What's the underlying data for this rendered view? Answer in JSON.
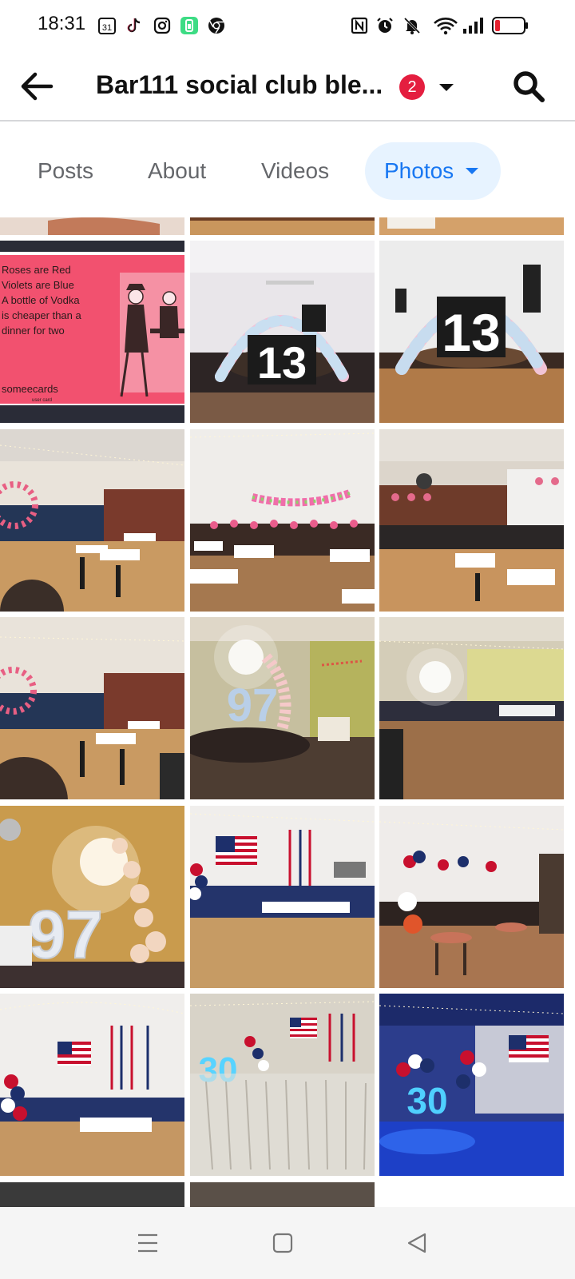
{
  "status_bar": {
    "time": "18:31",
    "calendar_day": "31",
    "icons": [
      "calendar-icon",
      "tiktok-icon",
      "instagram-icon",
      "battery-app-icon",
      "chrome-icon",
      "nfc-icon",
      "alarm-icon",
      "mute-icon",
      "wifi-icon",
      "signal-icon",
      "battery-icon"
    ]
  },
  "header": {
    "title": "Bar111 social club ble...",
    "badge_count": "2",
    "back_icon": "arrow-left-icon",
    "search_icon": "search-icon"
  },
  "tabs": [
    {
      "label": "Posts",
      "active": false
    },
    {
      "label": "About",
      "active": false
    },
    {
      "label": "Videos",
      "active": false
    },
    {
      "label": "Photos",
      "active": true
    }
  ],
  "photos": [
    {
      "desc": "partial top row photo",
      "row": 0
    },
    {
      "text_lines": [
        "Roses are Red",
        "Violets are Blue",
        "A bottle of Vodka",
        "is cheaper than a",
        "dinner for two"
      ],
      "brand": "someecards",
      "brand_sub": "user card"
    },
    {
      "number": "13"
    },
    {
      "number": "13"
    },
    {
      "number": "97"
    },
    {
      "number": "30"
    }
  ],
  "colors": {
    "accent": "#1877f2",
    "tab_active_bg": "#e7f3ff",
    "badge": "#e41e3f",
    "ecard_pink": "#f2516f"
  }
}
